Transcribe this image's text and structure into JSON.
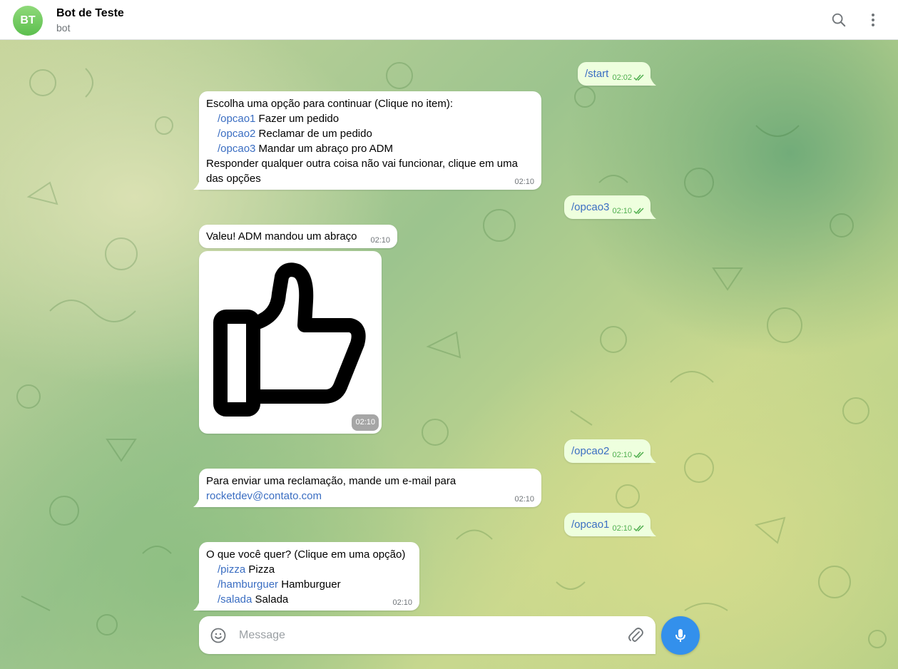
{
  "header": {
    "avatar_initials": "BT",
    "title": "Bot de Teste",
    "subtitle": "bot"
  },
  "messages": {
    "m1": {
      "text": "/start",
      "time": "02:02"
    },
    "m2": {
      "intro": "Escolha uma opção para continuar (Clique no item):",
      "options": [
        {
          "cmd": "/opcao1",
          "label": " Fazer um pedido"
        },
        {
          "cmd": "/opcao2",
          "label": " Reclamar de um pedido"
        },
        {
          "cmd": "/opcao3",
          "label": " Mandar um abraço pro ADM"
        }
      ],
      "outro": "Responder qualquer outra coisa não vai funcionar, clique em uma das opções",
      "time": "02:10"
    },
    "m3": {
      "text": "/opcao3",
      "time": "02:10"
    },
    "m4": {
      "text": "Valeu! ADM mandou um abraço",
      "time": "02:10"
    },
    "m5": {
      "sticker": "thumbs-up",
      "time": "02:10"
    },
    "m6": {
      "text": "/opcao2",
      "time": "02:10"
    },
    "m7": {
      "text": "Para enviar uma reclamação, mande um e-mail para",
      "link": "rocketdev@contato.com",
      "time": "02:10"
    },
    "m8": {
      "text": "/opcao1",
      "time": "02:10"
    },
    "m9": {
      "intro": "O que você quer? (Clique em uma opção)",
      "options": [
        {
          "cmd": "/pizza",
          "label": " Pizza"
        },
        {
          "cmd": "/hamburguer",
          "label": " Hamburguer"
        },
        {
          "cmd": "/salada",
          "label": " Salada"
        }
      ],
      "time": "02:10"
    }
  },
  "composer": {
    "placeholder": "Message"
  },
  "icons": {
    "search": "search-icon",
    "more": "more-vertical-icon",
    "emoji": "smile-icon",
    "attach": "paperclip-icon",
    "mic": "microphone-icon"
  },
  "colors": {
    "accent": "#3390ec",
    "outgoing_bubble": "#eeffde",
    "command_link": "#3b6ec2",
    "read_check": "#4fae4e"
  }
}
